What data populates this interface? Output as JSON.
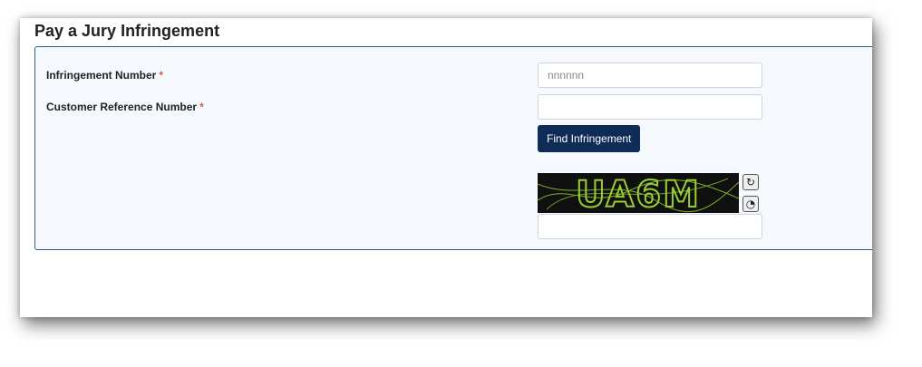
{
  "page": {
    "title": "Pay a Jury Infringement"
  },
  "form": {
    "infringement_label": "Infringement Number",
    "customer_ref_label": "Customer Reference Number",
    "required_mark": "*",
    "infringement_placeholder": "nnnnnn",
    "infringement_value": "",
    "customer_ref_value": "",
    "find_button": "Find Infringement",
    "captcha_text": "UA6M",
    "captcha_input_value": ""
  },
  "icons": {
    "refresh": "refresh-icon",
    "audio": "audio-icon"
  },
  "colors": {
    "button_bg": "#0f2c59",
    "panel_border": "#2f5c8a",
    "required": "#d9534f",
    "captcha_text": "#9acd32"
  }
}
